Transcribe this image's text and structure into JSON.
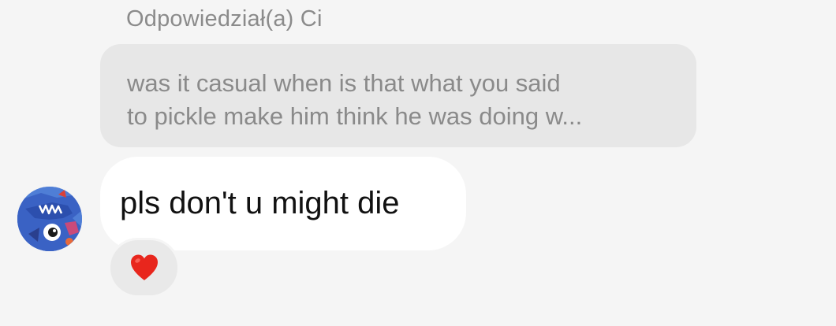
{
  "reply": {
    "header": "Odpowiedział(a) Ci",
    "quoted_lines": [
      "was it casual when is that what you said",
      "to pickle make him think he was doing w..."
    ]
  },
  "message": {
    "text": "pls don't u might die"
  },
  "reaction": {
    "emoji": "heart-icon",
    "color": "#e8261d"
  },
  "avatar": {
    "icon": "avatar-icon"
  },
  "colors": {
    "background": "#f5f5f5",
    "quoted_bubble": "#e7e7e7",
    "message_bubble": "#ffffff",
    "reaction_pill": "#e9e9e9",
    "muted_text": "#8b8b8b"
  }
}
